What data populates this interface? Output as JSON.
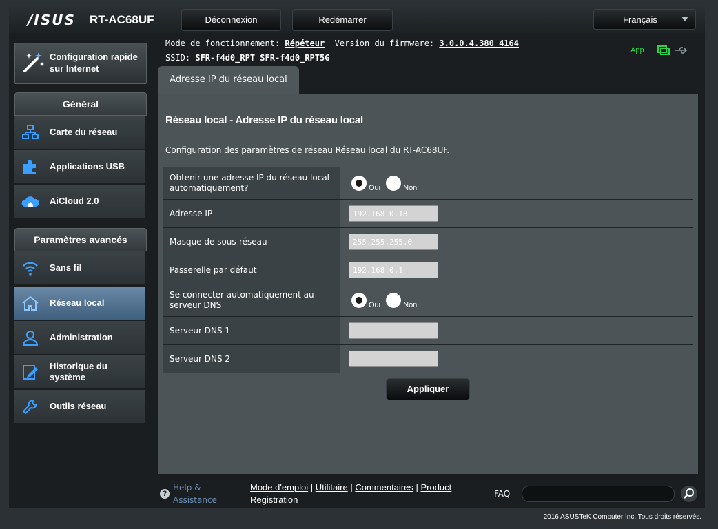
{
  "header": {
    "logo": "/ISUS",
    "model": "RT-AC68UF",
    "logout_label": "Déconnexion",
    "reboot_label": "Redémarrer",
    "language": "Français"
  },
  "status": {
    "mode_label": "Mode de fonctionnement:",
    "mode_value": "Répéteur",
    "firmware_label": "Version du firmware:",
    "firmware_value": "3.0.0.4.380_4164",
    "ssid_label": "SSID:",
    "ssid_1": "SFR-f4d0_RPT",
    "ssid_2": "SFR-f4d0_RPT5G",
    "app_label": "App"
  },
  "sidebar": {
    "qis_label": "Configuration rapide sur Internet",
    "general_title": "Général",
    "general_items": [
      {
        "label": "Carte du réseau"
      },
      {
        "label": "Applications USB"
      },
      {
        "label": "AiCloud 2.0"
      }
    ],
    "advanced_title": "Paramètres avancés",
    "advanced_items": [
      {
        "label": "Sans fil"
      },
      {
        "label": "Réseau local"
      },
      {
        "label": "Administration"
      },
      {
        "label": "Historique du système"
      },
      {
        "label": "Outils réseau"
      }
    ]
  },
  "main": {
    "tab_label": "Adresse IP du réseau local",
    "title": "Réseau local - Adresse IP du réseau local",
    "description": "Configuration des paramètres de réseau Réseau local du RT-AC68UF.",
    "fields": {
      "dhcp_label": "Obtenir une adresse IP du réseau local automatiquement?",
      "yes": "Oui",
      "no": "Non",
      "ip_label": "Adresse IP",
      "ip_value": "192.168.0.18",
      "mask_label": "Masque de sous-réseau",
      "mask_value": "255.255.255.0",
      "gateway_label": "Passerelle par défaut",
      "gateway_value": "192.168.0.1",
      "dns_auto_label": "Se connecter automatiquement au serveur DNS",
      "dns1_label": "Serveur DNS 1",
      "dns1_value": "",
      "dns2_label": "Serveur DNS 2",
      "dns2_value": ""
    },
    "apply_label": "Appliquer"
  },
  "footer": {
    "help": "Help & Assistance",
    "manual": "Mode d'emploi",
    "utility": "Utilitaire",
    "feedback": "Commentaires",
    "registration": "Product Registration",
    "faq": "FAQ",
    "copyright": "2016 ASUSTeK Computer Inc. Tous droits réservés."
  }
}
